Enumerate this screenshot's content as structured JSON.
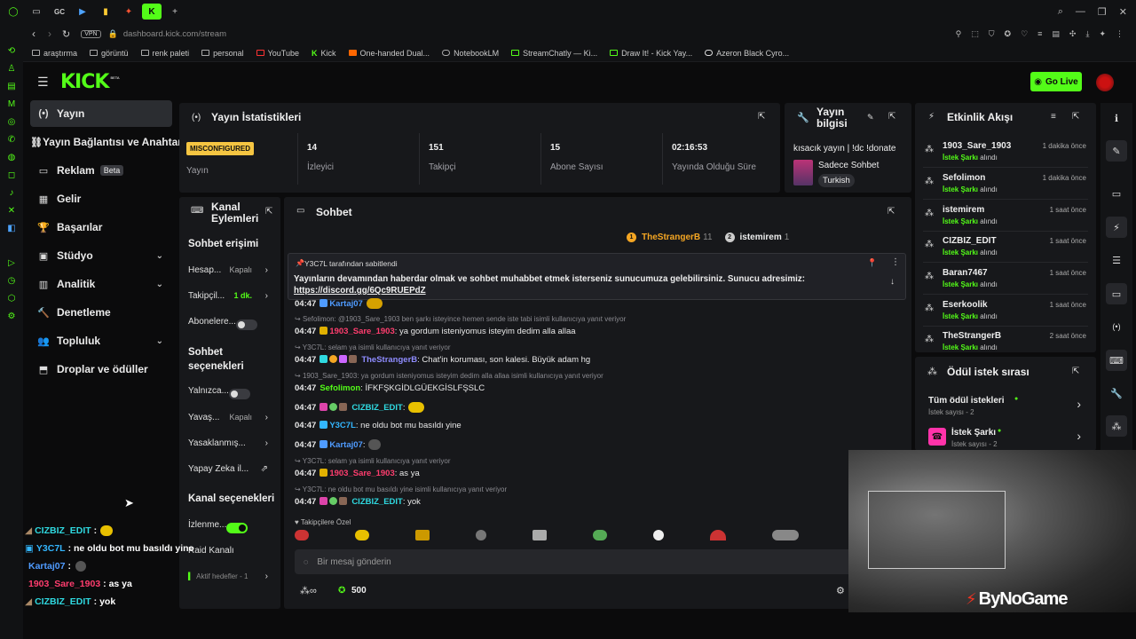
{
  "browser": {
    "url_host": "dashboard.kick.com",
    "url_path": "/stream",
    "vpn": "VPN",
    "tab_labels": [
      "GC"
    ],
    "bookmarks": [
      "araştırma",
      "görüntü",
      "renk paleti",
      "personal",
      "YouTube",
      "Kick",
      "One-handed Dual...",
      "NotebookLM",
      "StreamChatly — Ki...",
      "Draw It! - Kick Yay...",
      "Azeron Black Cyro..."
    ]
  },
  "header": {
    "logo": "KICK",
    "logo_tag": "BETA",
    "go_live": "Go Live"
  },
  "nav": {
    "items": [
      {
        "label": "Yayın",
        "icon": "(•)"
      },
      {
        "label": "Yayın Bağlantısı ve Anahtarı",
        "icon": "⛓"
      },
      {
        "label": "Reklam",
        "icon": "▭",
        "badge": "Beta"
      },
      {
        "label": "Gelir",
        "icon": "▦"
      },
      {
        "label": "Başarılar",
        "icon": "🏆"
      },
      {
        "label": "Stüdyo",
        "icon": "▣"
      },
      {
        "label": "Analitik",
        "icon": "▥"
      },
      {
        "label": "Denetleme",
        "icon": "🔨"
      },
      {
        "label": "Topluluk",
        "icon": "👥"
      },
      {
        "label": "Droplar ve ödüller",
        "icon": "⬒"
      }
    ]
  },
  "stats": {
    "title": "Yayın İstatistikleri",
    "status": "MISCONFIGURED",
    "status_label": "Yayın",
    "items": [
      {
        "value": "14",
        "label": "İzleyici"
      },
      {
        "value": "151",
        "label": "Takipçi"
      },
      {
        "value": "15",
        "label": "Abone Sayısı"
      },
      {
        "value": "02:16:53",
        "label": "Yayında Olduğu Süre"
      }
    ]
  },
  "stream_info": {
    "title": "Yayın bilgisi",
    "stream_title": "kısacık yayın | !dc !donate",
    "category": "Sadece Sohbet",
    "tag": "Turkish"
  },
  "channel_actions": {
    "title": "Kanal Eylemleri",
    "chat_access": "Sohbet erişimi",
    "rows1": [
      {
        "label": "Hesap...",
        "value": "Kapalı"
      },
      {
        "label": "Takipçil...",
        "value": "1 dk."
      },
      {
        "label": "Abonelere..."
      }
    ],
    "chat_options": "Sohbet seçenekleri",
    "rows2": [
      {
        "label": "Yalnızca..."
      },
      {
        "label": "Yavaş...",
        "value": "Kapalı"
      },
      {
        "label": "Yasaklanmış..."
      },
      {
        "label": "Yapay Zeka il..."
      }
    ],
    "channel_options": "Kanal seçenekleri",
    "rows3": [
      {
        "label": "İzlenme..."
      },
      {
        "label": "Raid Kanalı"
      },
      {
        "label": "Aktif hedefler - 1"
      }
    ]
  },
  "chat": {
    "title": "Sohbet",
    "top_gifters": [
      {
        "name": "TheStrangerB",
        "count": "11",
        "rank": "1"
      },
      {
        "name": "istemirem",
        "count": "1",
        "rank": "2"
      }
    ],
    "pinned_by": "Y3C7L tarafından sabitlendi",
    "pinned_text": "Yayınların devamından haberdar olmak ve sohbet muhabbet etmek isterseniz sunucumuza gelebilirsiniz. Sunucu adresimiz:",
    "pinned_link": "https://discord.gg/6Qc9RUEPdZ",
    "messages": [
      {
        "time": "04:47",
        "user": "Kartaj07",
        "color": "#4f9bff",
        "text": ""
      },
      {
        "reply": "Sefolimon: @1903_Sare_1903 ben şarkı isteyince hemen sende iste tabi isimli kullanıcıya yanıt veriyor"
      },
      {
        "time": "04:47",
        "user": "1903_Sare_1903",
        "color": "#ff3d6e",
        "text": ": ya gordum isteniyomus isteyim dedim alla allaa"
      },
      {
        "reply": "Y3C7L: selam ya isimli kullanıcıya yanıt veriyor"
      },
      {
        "time": "04:47",
        "user": "TheStrangerB",
        "color": "#8f8cff",
        "text": ": Chat'in koruması, son kalesi. Büyük adam hg"
      },
      {
        "reply": "1903_Sare_1903: ya gordum isteniyomus isteyim dedim alla allaa isimli kullanıcıya yanıt veriyor"
      },
      {
        "time": "04:47",
        "user": "Sefolimon",
        "color": "#53fc18",
        "text": ": İFKFŞKGİDLGÜEKGİSLFŞSLC"
      },
      {
        "time": "04:47",
        "user": "CIZBIZ_EDIT",
        "color": "#2fd9e0",
        "text": ":"
      },
      {
        "time": "04:47",
        "user": "Y3C7L",
        "color": "#33b6ff",
        "text": ": ne oldu bot mu basıldı yine"
      },
      {
        "time": "04:47",
        "user": "Kartaj07",
        "color": "#4f9bff",
        "text": ":"
      },
      {
        "reply": "Y3C7L: selam ya isimli kullanıcıya yanıt veriyor"
      },
      {
        "time": "04:47",
        "user": "1903_Sare_1903",
        "color": "#ff3d6e",
        "text": ": as ya"
      },
      {
        "reply": "Y3C7L: ne oldu bot mu basıldı yine isimli kullanıcıya yanıt veriyor"
      },
      {
        "time": "04:47",
        "user": "CIZBIZ_EDIT",
        "color": "#2fd9e0",
        "text": ": yok"
      }
    ],
    "emote_label": "Takipçilere Özel",
    "input_placeholder": "Bir mesaj gönderin",
    "points": "500"
  },
  "activity": {
    "title": "Etkinlik Akışı",
    "items": [
      {
        "name": "1903_Sare_1903",
        "time": "1 dakika önce"
      },
      {
        "name": "Sefolimon",
        "time": "1 dakika önce"
      },
      {
        "name": "istemirem",
        "time": "1 saat önce"
      },
      {
        "name": "CIZBIZ_EDIT",
        "time": "1 saat önce"
      },
      {
        "name": "Baran7467",
        "time": "1 saat önce"
      },
      {
        "name": "Eserkoolik",
        "time": "1 saat önce"
      },
      {
        "name": "TheStrangerB",
        "time": "2 saat önce"
      }
    ],
    "sub_pre": "İstek Şarkı",
    "sub_post": "alındı"
  },
  "rewards": {
    "title": "Ödül istek sırası",
    "all": "Tüm ödül istekleri",
    "all_sub": "İstek sayısı - 2",
    "song": "İstek Şarkı",
    "song_sub": "İstek sayısı - 2"
  },
  "overlay_chat": [
    {
      "user": "CIZBIZ_EDIT",
      "color": "#2fd9e0",
      "text": ":"
    },
    {
      "user": "Y3C7L",
      "color": "#33b6ff",
      "text": ": ne oldu bot mu basıldı yine"
    },
    {
      "user": "Kartaj07",
      "color": "#4f9bff",
      "text": ":"
    },
    {
      "user": "1903_Sare_1903",
      "color": "#ff3d6e",
      "text": ": as ya"
    },
    {
      "user": "CIZBIZ_EDIT",
      "color": "#2fd9e0",
      "text": ": yok"
    }
  ],
  "watermark": "ByNoGame",
  "colors": {
    "accent": "#53fc18",
    "panel": "#17181b",
    "bg": "#0b0b0c"
  }
}
